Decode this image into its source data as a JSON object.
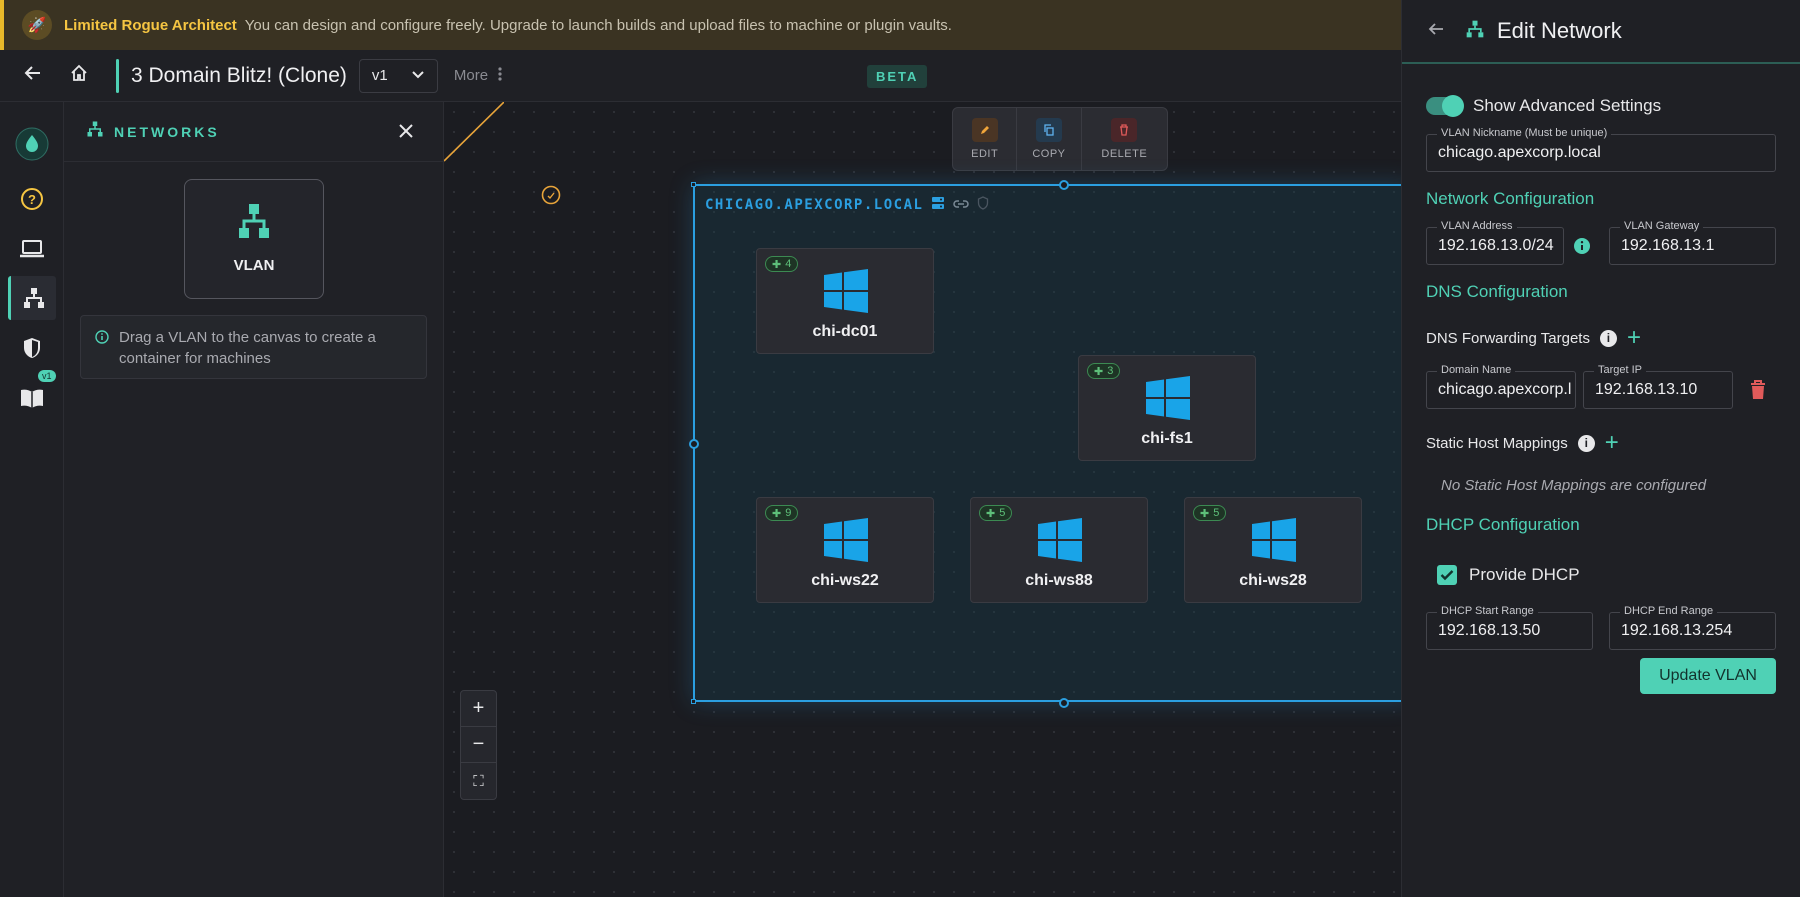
{
  "banner": {
    "tier": "Limited Rogue Architect",
    "message": "You can design and configure freely. Upgrade to launch builds and upload files to machine or plugin vaults."
  },
  "header": {
    "project_title": "3 Domain Blitz! (Clone)",
    "version": "v1",
    "more_label": "More",
    "beta_label": "BETA"
  },
  "rail": {
    "docs_badge": "v1"
  },
  "networks_panel": {
    "title": "NETWORKS",
    "tile_label": "VLAN",
    "hint": "Drag a VLAN to the canvas to create a container for machines"
  },
  "canvas": {
    "toolbar": {
      "edit": "EDIT",
      "copy": "COPY",
      "delete": "DELETE"
    },
    "vlan_name": "CHICAGO.APEXCORP.LOCAL",
    "machines": [
      {
        "name": "chi-dc01",
        "plugins": "4"
      },
      {
        "name": "chi-fs1",
        "plugins": "3"
      },
      {
        "name": "chi-ws22",
        "plugins": "9"
      },
      {
        "name": "chi-ws88",
        "plugins": "5"
      },
      {
        "name": "chi-ws28",
        "plugins": "5"
      }
    ],
    "zoom": {
      "in": "+",
      "out": "−",
      "fit": "⛶"
    }
  },
  "edit_panel": {
    "title": "Edit Network",
    "advanced_label": "Show Advanced Settings",
    "advanced_on": true,
    "nickname_label": "VLAN Nickname (Must be unique)",
    "nickname_value": "chicago.apexcorp.local",
    "network_config_title": "Network Configuration",
    "address_label": "VLAN Address",
    "address_value": "192.168.13.0/24",
    "gateway_label": "VLAN Gateway",
    "gateway_value": "192.168.13.1",
    "dns_config_title": "DNS Configuration",
    "dns_forwarding_label": "DNS Forwarding Targets",
    "domain_name_label": "Domain Name",
    "domain_name_value": "chicago.apexcorp.local",
    "target_ip_label": "Target IP",
    "target_ip_value": "192.168.13.10",
    "static_hosts_label": "Static Host Mappings",
    "static_hosts_empty": "No Static Host Mappings are configured",
    "dhcp_config_title": "DHCP Configuration",
    "provide_dhcp_label": "Provide DHCP",
    "provide_dhcp_checked": true,
    "dhcp_start_label": "DHCP Start Range",
    "dhcp_start_value": "192.168.13.50",
    "dhcp_end_label": "DHCP End Range",
    "dhcp_end_value": "192.168.13.254",
    "update_button": "Update VLAN"
  },
  "colors": {
    "accent": "#4fd1b5",
    "vlan_blue": "#2b9fe0",
    "banner_gold": "#f5c542",
    "windows_blue": "#19a4e8",
    "danger": "#e05a5a"
  }
}
